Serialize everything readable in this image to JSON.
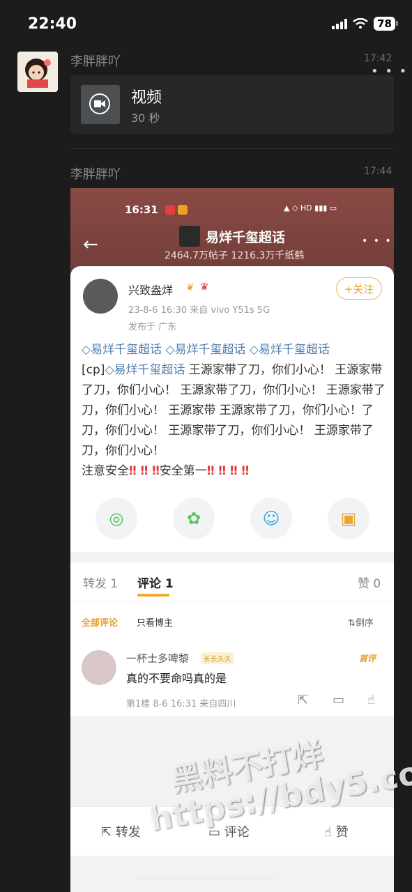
{
  "status_bar": {
    "time": "22:40",
    "battery": "78"
  },
  "messages": [
    {
      "sender": "李胖胖吖",
      "time": "17:42",
      "video": {
        "title": "视频",
        "duration": "30 秒"
      }
    },
    {
      "sender": "李胖胖吖",
      "time": "17:44"
    }
  ],
  "screenshot": {
    "status_time": "16:31",
    "topic": {
      "title": "易烊千玺超话",
      "stats": "2464.7万帖子 1216.3万千纸鹤"
    },
    "post": {
      "user": "兴致盎烊",
      "follow_label": "+关注",
      "meta": "23-8-6 16:30  来自 vivo Y51s 5G",
      "location": "发布于 广东",
      "tag": "易烊千玺超话",
      "cp": "[cp]",
      "body_1": "王源家带了刀，你们小心！",
      "body_2": "王源家带了刀，你们小心！ 王源家带了刀，你们小心！ 王源家带了刀，你们小心！ 王源家带 王源家带了刀，你们小心！了刀，你们小心！ 王源家带了刀，你们小心！ 王源家带了刀，你们小心！",
      "warning_1": "注意安全",
      "warning_2": "安全第一",
      "bangs": "‼ ‼ ‼",
      "bangs_2": "‼ ‼ ‼ ‼"
    },
    "tabs": {
      "repost": "转发 1",
      "comments": "评论 1",
      "likes": "赞 0"
    },
    "filters": {
      "all": "全部评论",
      "op_only": "只看博主",
      "sort": "倒序"
    },
    "comment": {
      "user": "一杯士多啤黎",
      "badge": "长长久久",
      "first_label": "首评",
      "text": "真的不要命吗真的是",
      "meta": "第1楼  8-6 16:31  来自四川"
    },
    "bottom_bar": {
      "repost": "转发",
      "comment": "评论",
      "like": "赞"
    }
  },
  "watermark": {
    "line1": "黑料不打烊",
    "line2": "https://bdy5.co"
  }
}
